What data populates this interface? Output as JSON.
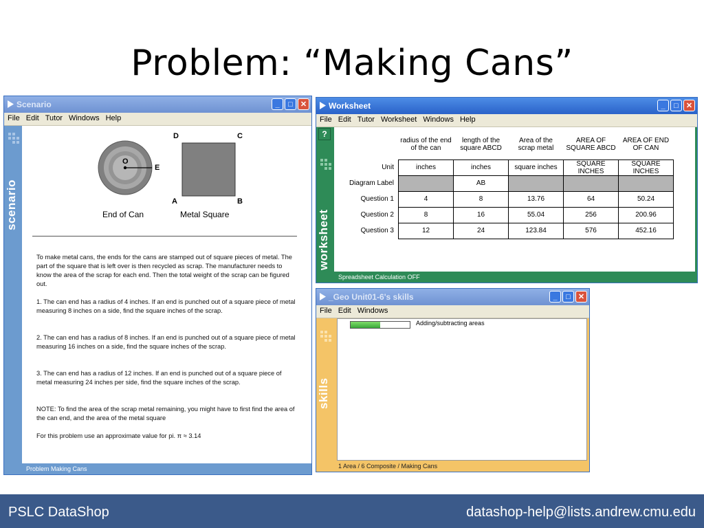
{
  "slide": {
    "title": "Problem: “Making Cans”",
    "footer_left": "PSLC DataShop",
    "footer_right": "datashop-help@lists.andrew.cmu.edu"
  },
  "scenario": {
    "window_title": "Scenario",
    "menu": [
      "File",
      "Edit",
      "Tutor",
      "Windows",
      "Help"
    ],
    "sidebar_label": "scenario",
    "diagram": {
      "point_center": "O",
      "point_edge": "E",
      "can_caption": "End of Can",
      "corner_a": "A",
      "corner_b": "B",
      "corner_c": "C",
      "corner_d": "D",
      "square_caption": "Metal Square"
    },
    "paragraphs": [
      "To make metal cans, the ends for the cans are stamped out of square pieces of metal. The part of the square that is left over is then recycled as scrap. The manufacturer needs to know the area of the scrap for each end. Then the total weight of the scrap can be figured out.",
      "1. The can end has a radius of 4 inches. If an end is punched out of a square piece of metal measuring 8 inches on a side, find the square inches of the scrap.",
      "2. The can end has a radius of 8 inches. If an end is punched out of a square piece of metal measuring 16 inches on a side, find the square inches of the scrap.",
      "3. The can end has a radius of 12 inches. If an end is punched out of a square piece of metal measuring 24 inches per side, find the square inches of the scrap.",
      "NOTE: To find the area of the scrap metal remaining, you might have to first find the area of the can end, and the area of the metal square",
      "For this problem use an approximate value for pi. π ≈ 3.14"
    ],
    "status": "Problem Making Cans"
  },
  "worksheet": {
    "window_title": "Worksheet",
    "menu": [
      "File",
      "Edit",
      "Tutor",
      "Worksheet",
      "Windows",
      "Help"
    ],
    "sidebar_label": "worksheet",
    "help_label": "?",
    "columns": [
      "radius of the end of the can",
      "length of the square ABCD",
      "Area of the scrap metal",
      "AREA OF SQUARE ABCD",
      "AREA OF END OF CAN"
    ],
    "rows": [
      {
        "label": "Unit",
        "cells": [
          "inches",
          "inches",
          "square inches",
          "SQUARE INCHES",
          "SQUARE INCHES"
        ]
      },
      {
        "label": "Diagram Label",
        "cells": [
          "",
          "AB",
          "",
          "",
          ""
        ]
      },
      {
        "label": "Question 1",
        "cells": [
          "4",
          "8",
          "13.76",
          "64",
          "50.24"
        ]
      },
      {
        "label": "Question 2",
        "cells": [
          "8",
          "16",
          "55.04",
          "256",
          "200.96"
        ]
      },
      {
        "label": "Question 3",
        "cells": [
          "12",
          "24",
          "123.84",
          "576",
          "452.16"
        ]
      }
    ],
    "status": "Spreadsheet Calculation OFF"
  },
  "skills": {
    "window_title": "_Geo Unit01-6's skills",
    "menu": [
      "File",
      "Edit",
      "Windows"
    ],
    "sidebar_label": "skills",
    "skill_name": "Adding/subtracting areas",
    "skill_progress": 0.5,
    "status": "1 Area / 6 Composite / Making Cans"
  },
  "colors": {
    "scenario_accent": "#6c9bcf",
    "worksheet_accent": "#2e8b57",
    "skills_accent": "#f4c467",
    "footer_bg": "#3b5a8a"
  }
}
